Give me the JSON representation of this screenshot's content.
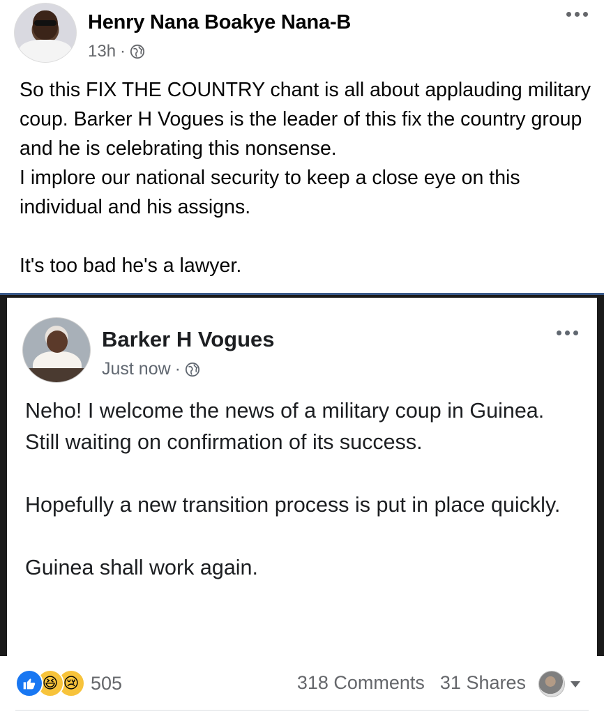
{
  "post": {
    "author": "Henry Nana Boakye Nana-B",
    "time": "13h",
    "separator": "·",
    "privacy_icon": "globe-icon",
    "paragraphs": [
      "So this FIX THE COUNTRY chant is all about applauding military coup. Barker H Vogues is the leader of this fix the country group and he is celebrating this nonsense.",
      "I implore our national security to keep a close eye on this individual and his assigns.",
      "It's too bad he's a lawyer."
    ]
  },
  "embedded": {
    "author": "Barker H Vogues",
    "time": "Just now",
    "separator": "·",
    "privacy_icon": "globe-icon",
    "lines": [
      "Neho! I welcome the news of a military coup in Guinea.",
      "Still waiting on confirmation of its success.",
      "Hopefully a new transition process is put in place quickly.",
      "Guinea shall work again."
    ]
  },
  "footer": {
    "reactions": [
      "like-icon",
      "haha-icon",
      "sad-icon"
    ],
    "reaction_count": "505",
    "comments": "318 Comments",
    "shares": "31 Shares"
  },
  "colors": {
    "text": "#050505",
    "meta": "#65676b",
    "like_blue": "#1877f2",
    "emoji_yellow": "#f7c33b"
  }
}
